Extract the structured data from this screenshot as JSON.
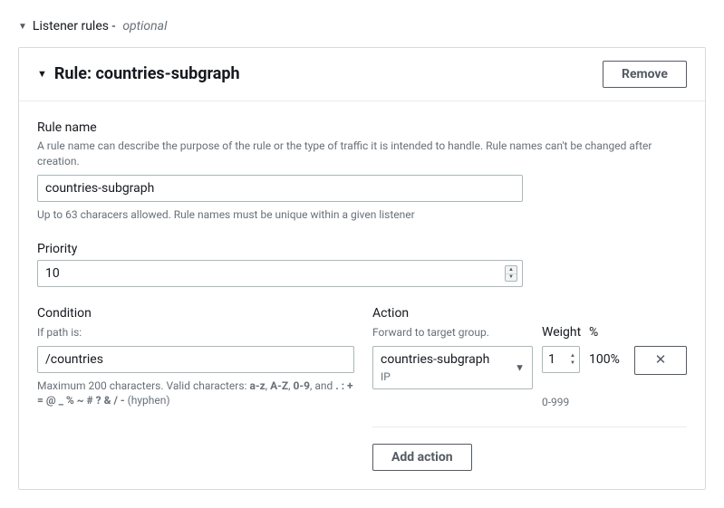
{
  "section": {
    "title": "Listener rules -",
    "optional": "optional"
  },
  "rule": {
    "title": "Rule: countries-subgraph",
    "remove_label": "Remove"
  },
  "ruleName": {
    "label": "Rule name",
    "description": "A rule name can describe the purpose of the rule or the type of traffic it is intended to handle. Rule names can't be changed after creation.",
    "value": "countries-subgraph",
    "hint": "Up to 63 characers allowed. Rule names must be unique within a given listener"
  },
  "priority": {
    "label": "Priority",
    "value": "10"
  },
  "condition": {
    "label": "Condition",
    "sublabel": "If path is:",
    "value": "/countries",
    "hint_prefix": "Maximum 200 characters. Valid characters: ",
    "hint_bold1": "a-z",
    "hint_sep1": ", ",
    "hint_bold2": "A-Z",
    "hint_sep2": ", ",
    "hint_bold3": "0-9",
    "hint_mid": ", and ",
    "hint_bold4": ". : + = @ _ % ~ # ? & / -",
    "hint_suffix": " (hyphen)"
  },
  "action": {
    "label": "Action",
    "sublabel": "Forward to target group.",
    "target_value": "countries-subgraph",
    "target_sub": "IP",
    "weight_label": "Weight",
    "pct_label": "%",
    "weight_value": "1",
    "pct_value": "100%",
    "range_hint": "0-999",
    "add_label": "Add action"
  }
}
